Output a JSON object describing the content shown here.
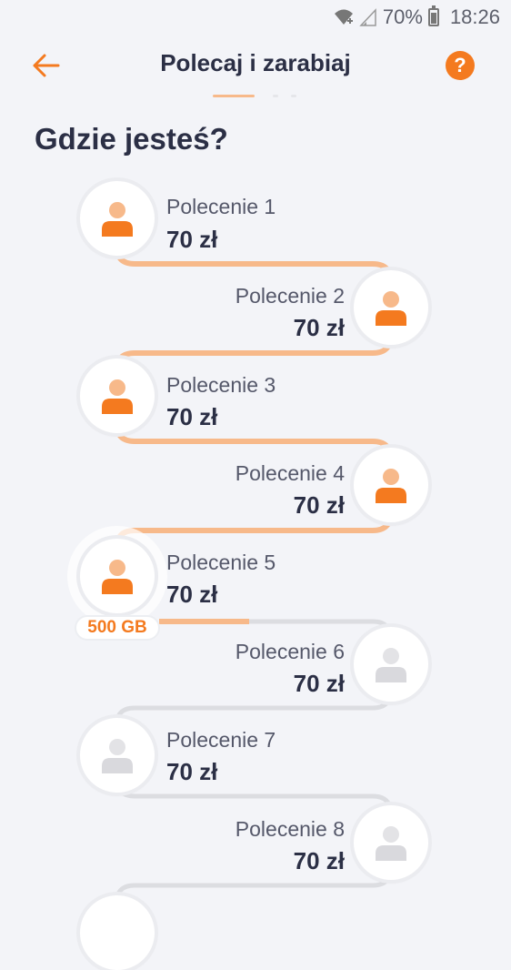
{
  "status_bar": {
    "battery": "70%",
    "time": "18:26"
  },
  "header": {
    "title": "Polecaj i zarabiaj",
    "back_icon": "arrow-left-icon",
    "help_label": "?"
  },
  "heading": "Gdzie jesteś?",
  "colors": {
    "accent": "#f47a1f",
    "accent_light": "#f7b98a",
    "inactive": "#d9d9dd",
    "text_dark": "#2b2f45"
  },
  "steps": [
    {
      "label": "Polecenie 1",
      "amount": "70 zł",
      "active": true
    },
    {
      "label": "Polecenie 2",
      "amount": "70 zł",
      "active": true
    },
    {
      "label": "Polecenie 3",
      "amount": "70 zł",
      "active": true
    },
    {
      "label": "Polecenie 4",
      "amount": "70 zł",
      "active": true
    },
    {
      "label": "Polecenie 5",
      "amount": "70 zł",
      "active": true,
      "badge": "500 GB"
    },
    {
      "label": "Polecenie 6",
      "amount": "70 zł",
      "active": false
    },
    {
      "label": "Polecenie 7",
      "amount": "70 zł",
      "active": false
    },
    {
      "label": "Polecenie 8",
      "amount": "70 zł",
      "active": false
    }
  ]
}
